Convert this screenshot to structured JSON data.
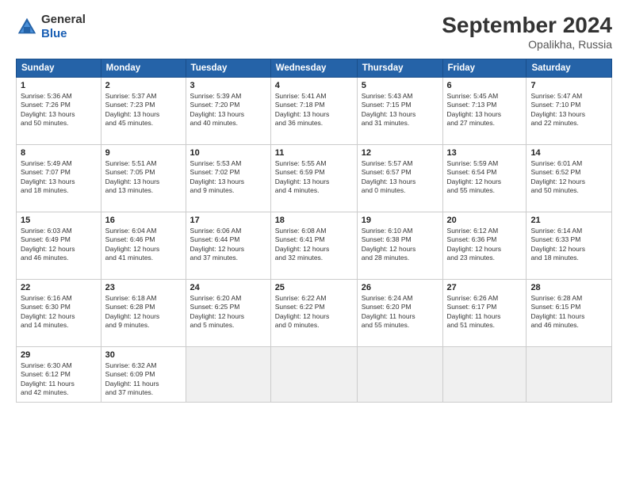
{
  "header": {
    "logo_line1": "General",
    "logo_line2": "Blue",
    "month_title": "September 2024",
    "location": "Opalikha, Russia"
  },
  "weekdays": [
    "Sunday",
    "Monday",
    "Tuesday",
    "Wednesday",
    "Thursday",
    "Friday",
    "Saturday"
  ],
  "weeks": [
    [
      {
        "day": "1",
        "info": "Sunrise: 5:36 AM\nSunset: 7:26 PM\nDaylight: 13 hours\nand 50 minutes."
      },
      {
        "day": "2",
        "info": "Sunrise: 5:37 AM\nSunset: 7:23 PM\nDaylight: 13 hours\nand 45 minutes."
      },
      {
        "day": "3",
        "info": "Sunrise: 5:39 AM\nSunset: 7:20 PM\nDaylight: 13 hours\nand 40 minutes."
      },
      {
        "day": "4",
        "info": "Sunrise: 5:41 AM\nSunset: 7:18 PM\nDaylight: 13 hours\nand 36 minutes."
      },
      {
        "day": "5",
        "info": "Sunrise: 5:43 AM\nSunset: 7:15 PM\nDaylight: 13 hours\nand 31 minutes."
      },
      {
        "day": "6",
        "info": "Sunrise: 5:45 AM\nSunset: 7:13 PM\nDaylight: 13 hours\nand 27 minutes."
      },
      {
        "day": "7",
        "info": "Sunrise: 5:47 AM\nSunset: 7:10 PM\nDaylight: 13 hours\nand 22 minutes."
      }
    ],
    [
      {
        "day": "8",
        "info": "Sunrise: 5:49 AM\nSunset: 7:07 PM\nDaylight: 13 hours\nand 18 minutes."
      },
      {
        "day": "9",
        "info": "Sunrise: 5:51 AM\nSunset: 7:05 PM\nDaylight: 13 hours\nand 13 minutes."
      },
      {
        "day": "10",
        "info": "Sunrise: 5:53 AM\nSunset: 7:02 PM\nDaylight: 13 hours\nand 9 minutes."
      },
      {
        "day": "11",
        "info": "Sunrise: 5:55 AM\nSunset: 6:59 PM\nDaylight: 13 hours\nand 4 minutes."
      },
      {
        "day": "12",
        "info": "Sunrise: 5:57 AM\nSunset: 6:57 PM\nDaylight: 13 hours\nand 0 minutes."
      },
      {
        "day": "13",
        "info": "Sunrise: 5:59 AM\nSunset: 6:54 PM\nDaylight: 12 hours\nand 55 minutes."
      },
      {
        "day": "14",
        "info": "Sunrise: 6:01 AM\nSunset: 6:52 PM\nDaylight: 12 hours\nand 50 minutes."
      }
    ],
    [
      {
        "day": "15",
        "info": "Sunrise: 6:03 AM\nSunset: 6:49 PM\nDaylight: 12 hours\nand 46 minutes."
      },
      {
        "day": "16",
        "info": "Sunrise: 6:04 AM\nSunset: 6:46 PM\nDaylight: 12 hours\nand 41 minutes."
      },
      {
        "day": "17",
        "info": "Sunrise: 6:06 AM\nSunset: 6:44 PM\nDaylight: 12 hours\nand 37 minutes."
      },
      {
        "day": "18",
        "info": "Sunrise: 6:08 AM\nSunset: 6:41 PM\nDaylight: 12 hours\nand 32 minutes."
      },
      {
        "day": "19",
        "info": "Sunrise: 6:10 AM\nSunset: 6:38 PM\nDaylight: 12 hours\nand 28 minutes."
      },
      {
        "day": "20",
        "info": "Sunrise: 6:12 AM\nSunset: 6:36 PM\nDaylight: 12 hours\nand 23 minutes."
      },
      {
        "day": "21",
        "info": "Sunrise: 6:14 AM\nSunset: 6:33 PM\nDaylight: 12 hours\nand 18 minutes."
      }
    ],
    [
      {
        "day": "22",
        "info": "Sunrise: 6:16 AM\nSunset: 6:30 PM\nDaylight: 12 hours\nand 14 minutes."
      },
      {
        "day": "23",
        "info": "Sunrise: 6:18 AM\nSunset: 6:28 PM\nDaylight: 12 hours\nand 9 minutes."
      },
      {
        "day": "24",
        "info": "Sunrise: 6:20 AM\nSunset: 6:25 PM\nDaylight: 12 hours\nand 5 minutes."
      },
      {
        "day": "25",
        "info": "Sunrise: 6:22 AM\nSunset: 6:22 PM\nDaylight: 12 hours\nand 0 minutes."
      },
      {
        "day": "26",
        "info": "Sunrise: 6:24 AM\nSunset: 6:20 PM\nDaylight: 11 hours\nand 55 minutes."
      },
      {
        "day": "27",
        "info": "Sunrise: 6:26 AM\nSunset: 6:17 PM\nDaylight: 11 hours\nand 51 minutes."
      },
      {
        "day": "28",
        "info": "Sunrise: 6:28 AM\nSunset: 6:15 PM\nDaylight: 11 hours\nand 46 minutes."
      }
    ],
    [
      {
        "day": "29",
        "info": "Sunrise: 6:30 AM\nSunset: 6:12 PM\nDaylight: 11 hours\nand 42 minutes."
      },
      {
        "day": "30",
        "info": "Sunrise: 6:32 AM\nSunset: 6:09 PM\nDaylight: 11 hours\nand 37 minutes."
      },
      {
        "day": "",
        "info": ""
      },
      {
        "day": "",
        "info": ""
      },
      {
        "day": "",
        "info": ""
      },
      {
        "day": "",
        "info": ""
      },
      {
        "day": "",
        "info": ""
      }
    ]
  ]
}
